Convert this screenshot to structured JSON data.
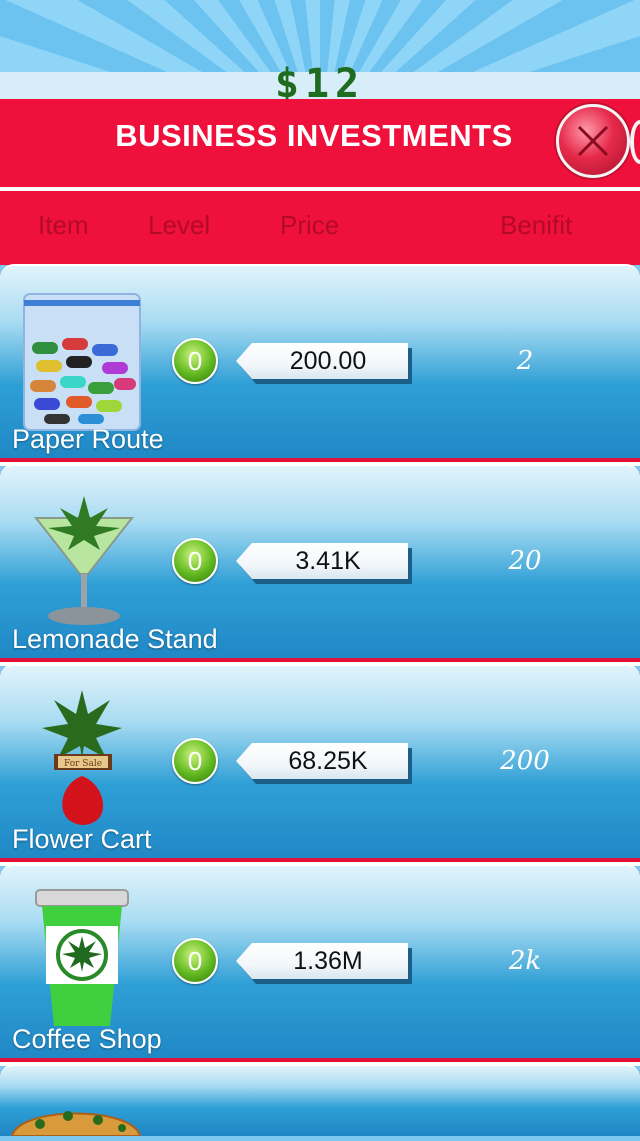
{
  "hud": {
    "money": "$12"
  },
  "header": {
    "title": "BUSINESS INVESTMENTS",
    "close_icon": "close-x-icon",
    "columns": {
      "item": "Item",
      "level": "Level",
      "price": "Price",
      "benefit": "Benifit"
    }
  },
  "colors": {
    "header_red": "#f0103c",
    "row_blue": "#2e9fd6",
    "level_green": "#62b81f"
  },
  "items": [
    {
      "name": "Paper Route",
      "level": "0",
      "price": "200.00",
      "benefit": "2",
      "icon": "pill-bag-icon"
    },
    {
      "name": "Lemonade Stand",
      "level": "0",
      "price": "3.41K",
      "benefit": "20",
      "icon": "cocktail-glass-icon"
    },
    {
      "name": "Flower Cart",
      "level": "0",
      "price": "68.25K",
      "benefit": "200",
      "icon": "plant-for-sale-icon"
    },
    {
      "name": "Coffee Shop",
      "level": "0",
      "price": "1.36M",
      "benefit": "2k",
      "icon": "coffee-cup-icon"
    },
    {
      "name": "",
      "level": "",
      "price": "",
      "benefit": "",
      "icon": "pizza-icon"
    }
  ]
}
